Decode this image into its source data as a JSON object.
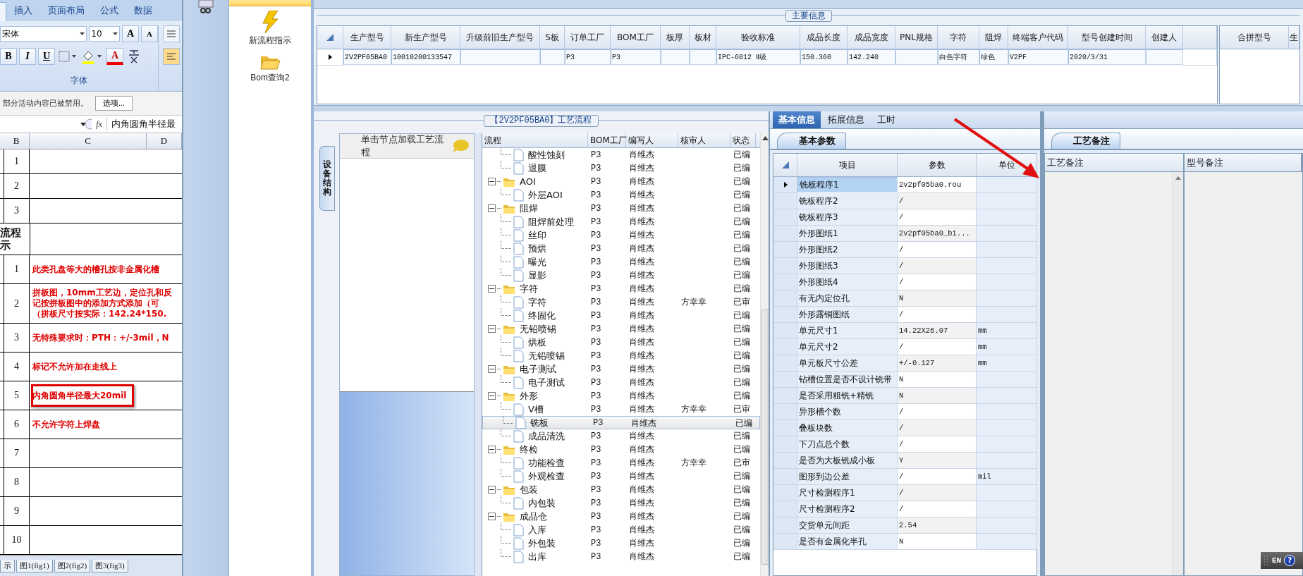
{
  "excel": {
    "ribbon_tabs": [
      "插入",
      "页面布局",
      "公式",
      "数据"
    ],
    "font_name": "宋体",
    "font_size": "10",
    "grow_font": "A",
    "shrink_font": "A",
    "format_buttons": [
      "B",
      "I",
      "U"
    ],
    "font_color_glyph": "A",
    "font_group_label": "字体",
    "security_message": "部分活动内容已被禁用。",
    "options_button": "选项...",
    "formula_fx": "fx",
    "formula_content": "内角圆角半径最",
    "columns": [
      "B",
      "C",
      "D"
    ],
    "rows": [
      {
        "kind": "item",
        "number": "1",
        "highlighted": false
      },
      {
        "kind": "item",
        "number": "2",
        "highlighted": false
      },
      {
        "kind": "item",
        "number": "3",
        "highlighted": false
      },
      {
        "kind": "label",
        "heading": [
          "流程",
          "示"
        ]
      },
      {
        "kind": "item",
        "number": "1",
        "lines": [
          "此类孔盘等大的槽孔按非金属化槽"
        ],
        "highlighted": false
      },
      {
        "kind": "item",
        "number": "2",
        "lines": [
          "拼板图，10mm工艺边，定位孔和反",
          "记按拼板图中的添加方式添加（可",
          "（拼板尺寸按实际：142.24*150."
        ],
        "highlighted": false
      },
      {
        "kind": "item",
        "number": "3",
        "lines": [
          "无特殊要求时：PTH：+/-3mil，N"
        ],
        "highlighted": false
      },
      {
        "kind": "item",
        "number": "4",
        "lines": [
          "标记不允许加在走线上"
        ],
        "highlighted": false
      },
      {
        "kind": "item",
        "number": "5",
        "lines": [
          "内角圆角半径最大20mil"
        ],
        "highlighted": true
      },
      {
        "kind": "item",
        "number": "6",
        "lines": [
          "不允许字符上焊盘"
        ],
        "highlighted": false
      },
      {
        "kind": "item",
        "number": "7",
        "highlighted": false
      },
      {
        "kind": "item",
        "number": "8",
        "highlighted": false
      },
      {
        "kind": "item",
        "number": "9",
        "highlighted": false
      },
      {
        "kind": "item",
        "number": "10",
        "highlighted": false
      }
    ],
    "sheet_tabs": [
      "示",
      "图1(fig1)",
      "图2(fig2)",
      "图3(fig3)"
    ]
  },
  "launcher": {
    "items": [
      {
        "kind": "lightning",
        "label": "新流程指示"
      },
      {
        "kind": "folder",
        "label": "Bom查询2"
      }
    ]
  },
  "main_info": {
    "title": "主要信息",
    "columns": [
      "生产型号",
      "新生产型号",
      "升级前旧生产型号",
      "S板",
      "订单工厂",
      "BOM工厂",
      "板厚",
      "板材",
      "验收标准",
      "成品长度",
      "成品宽度",
      "PNL规格",
      "字符",
      "阻焊",
      "终端客户代码",
      "型号创建时间",
      "创建人"
    ],
    "rows": [
      {
        "selected": true,
        "cells": [
          "2V2PF05BA0",
          "10010200133547",
          null,
          null,
          "P3",
          "P3",
          null,
          null,
          "IPC-6012 Ⅱ级",
          "150.360",
          "142.240",
          null,
          "白色字符",
          "绿色",
          "V2PF",
          "2020/3/31",
          null
        ]
      }
    ],
    "merge_columns": [
      "合拼型号",
      "生"
    ]
  },
  "process": {
    "title": "【2V2PF05BA0】工艺流程",
    "side_tab": "设备结构",
    "hint": "单击节点加载工艺流程",
    "columns": [
      "流程",
      "BOM工厂",
      "编写人",
      "核审人",
      "状态"
    ],
    "nodes": [
      {
        "kind": "step",
        "label": "酸性蚀刻",
        "bom": "P3",
        "author": "肖维杰",
        "status": "已编",
        "selected": false
      },
      {
        "kind": "step",
        "label": "退膜",
        "bom": "P3",
        "author": "肖维杰",
        "status": "已编",
        "selected": false
      },
      {
        "kind": "group",
        "label": "AOI",
        "bom": "P3",
        "author": "肖维杰",
        "status": "已编",
        "selected": false,
        "expanded": true,
        "children": [
          {
            "kind": "step",
            "label": "外层AOI",
            "bom": "P3",
            "author": "肖维杰",
            "status": "已编",
            "selected": false
          }
        ]
      },
      {
        "kind": "group",
        "label": "阻焊",
        "bom": "P3",
        "author": "肖维杰",
        "status": "已编",
        "selected": false,
        "expanded": true,
        "children": [
          {
            "kind": "step",
            "label": "阻焊前处理",
            "bom": "P3",
            "author": "肖维杰",
            "status": "已编",
            "selected": false
          },
          {
            "kind": "step",
            "label": "丝印",
            "bom": "P3",
            "author": "肖维杰",
            "status": "已编",
            "selected": false
          },
          {
            "kind": "step",
            "label": "预烘",
            "bom": "P3",
            "author": "肖维杰",
            "status": "已编",
            "selected": false
          },
          {
            "kind": "step",
            "label": "曝光",
            "bom": "P3",
            "author": "肖维杰",
            "status": "已编",
            "selected": false
          },
          {
            "kind": "step",
            "label": "显影",
            "bom": "P3",
            "author": "肖维杰",
            "status": "已编",
            "selected": false
          }
        ]
      },
      {
        "kind": "group",
        "label": "字符",
        "bom": "P3",
        "author": "肖维杰",
        "status": "已编",
        "selected": false,
        "expanded": true,
        "children": [
          {
            "kind": "step",
            "label": "字符",
            "bom": "P3",
            "author": "肖维杰",
            "reviewer": "方幸幸",
            "status": "已审",
            "selected": false
          },
          {
            "kind": "step",
            "label": "终固化",
            "bom": "P3",
            "author": "肖维杰",
            "status": "已编",
            "selected": false
          }
        ]
      },
      {
        "kind": "group",
        "label": "无铅喷锡",
        "bom": "P3",
        "author": "肖维杰",
        "status": "已编",
        "selected": false,
        "expanded": true,
        "children": [
          {
            "kind": "step",
            "label": "烘板",
            "bom": "P3",
            "author": "肖维杰",
            "status": "已编",
            "selected": false
          },
          {
            "kind": "step",
            "label": "无铅喷锡",
            "bom": "P3",
            "author": "肖维杰",
            "status": "已编",
            "selected": false
          }
        ]
      },
      {
        "kind": "group",
        "label": "电子测试",
        "bom": "P3",
        "author": "肖维杰",
        "status": "已编",
        "selected": false,
        "expanded": true,
        "children": [
          {
            "kind": "step",
            "label": "电子测试",
            "bom": "P3",
            "author": "肖维杰",
            "status": "已编",
            "selected": false
          }
        ]
      },
      {
        "kind": "group",
        "label": "外形",
        "bom": "P3",
        "author": "肖维杰",
        "status": "已编",
        "selected": false,
        "expanded": true,
        "children": [
          {
            "kind": "step",
            "label": "V槽",
            "bom": "P3",
            "author": "肖维杰",
            "reviewer": "方幸幸",
            "status": "已审",
            "selected": false
          },
          {
            "kind": "step",
            "label": "铣板",
            "bom": "P3",
            "author": "肖维杰",
            "status": "已编",
            "selected": true
          },
          {
            "kind": "step",
            "label": "成品清洗",
            "bom": "P3",
            "author": "肖维杰",
            "status": "已编",
            "selected": false
          }
        ]
      },
      {
        "kind": "group",
        "label": "终检",
        "bom": "P3",
        "author": "肖维杰",
        "status": "已编",
        "selected": false,
        "expanded": true,
        "children": [
          {
            "kind": "step",
            "label": "功能检查",
            "bom": "P3",
            "author": "肖维杰",
            "reviewer": "方幸幸",
            "status": "已审",
            "selected": false
          },
          {
            "kind": "step",
            "label": "外观检查",
            "bom": "P3",
            "author": "肖维杰",
            "status": "已编",
            "selected": false
          }
        ]
      },
      {
        "kind": "group",
        "label": "包装",
        "bom": "P3",
        "author": "肖维杰",
        "status": "已编",
        "selected": false,
        "expanded": true,
        "children": [
          {
            "kind": "step",
            "label": "内包装",
            "bom": "P3",
            "author": "肖维杰",
            "status": "已编",
            "selected": false
          }
        ]
      },
      {
        "kind": "group",
        "label": "成品仓",
        "bom": "P3",
        "author": "肖维杰",
        "status": "已编",
        "selected": false,
        "expanded": true,
        "children": [
          {
            "kind": "step",
            "label": "入库",
            "bom": "P3",
            "author": "肖维杰",
            "status": "已编",
            "selected": false
          },
          {
            "kind": "step",
            "label": "外包装",
            "bom": "P3",
            "author": "肖维杰",
            "status": "已编",
            "selected": false
          },
          {
            "kind": "step",
            "label": "出库",
            "bom": "P3",
            "author": "肖维杰",
            "status": "已编",
            "selected": false
          }
        ]
      }
    ]
  },
  "basic": {
    "tabs": [
      {
        "label": "基本信息",
        "selected": true
      },
      {
        "label": "拓展信息",
        "selected": false
      },
      {
        "label": "工时",
        "selected": false
      }
    ],
    "subtab": "基本参数",
    "columns": [
      "项目",
      "参数",
      "单位"
    ],
    "rows": [
      {
        "item": "铣板程序1",
        "value": "2v2pf05ba0.rou",
        "selected": true
      },
      {
        "item": "铣板程序2",
        "value": "/",
        "selected": false
      },
      {
        "item": "铣板程序3",
        "value": "/",
        "selected": false
      },
      {
        "item": "外形图纸1",
        "value": "2v2pf05ba0_bi...",
        "selected": false
      },
      {
        "item": "外形图纸2",
        "value": "/",
        "selected": false
      },
      {
        "item": "外形图纸3",
        "value": "/",
        "selected": false
      },
      {
        "item": "外形图纸4",
        "value": "/",
        "selected": false
      },
      {
        "item": "有无内定位孔",
        "value": "N",
        "selected": false
      },
      {
        "item": "外形露铜图纸",
        "value": "/",
        "selected": false
      },
      {
        "item": "单元尺寸1",
        "value": "14.22X26.07",
        "unit": "mm",
        "selected": false
      },
      {
        "item": "单元尺寸2",
        "value": "/",
        "unit": "mm",
        "selected": false
      },
      {
        "item": "单元板尺寸公差",
        "value": "+/-0.127",
        "unit": "mm",
        "selected": false
      },
      {
        "item": "钻槽位置是否不设计铣带",
        "value": "N",
        "selected": false
      },
      {
        "item": "是否采用粗铣+精铣",
        "value": "N",
        "selected": false
      },
      {
        "item": "异形槽个数",
        "value": "/",
        "selected": false
      },
      {
        "item": "叠板块数",
        "value": "/",
        "selected": false
      },
      {
        "item": "下刀点总个数",
        "value": "/",
        "selected": false
      },
      {
        "item": "是否为大板铣成小板",
        "value": "Y",
        "selected": false
      },
      {
        "item": "图形到边公差",
        "value": "/",
        "unit": "mil",
        "selected": false
      },
      {
        "item": "尺寸检测程序1",
        "value": "/",
        "selected": false
      },
      {
        "item": "尺寸检测程序2",
        "value": "/",
        "selected": false
      },
      {
        "item": "交货单元间距",
        "value": "2.54",
        "selected": false
      },
      {
        "item": "是否有金属化半孔",
        "value": "N",
        "selected": false
      }
    ]
  },
  "notes": {
    "tab": "工艺备注",
    "columns": [
      "工艺备注",
      "型号备注"
    ]
  },
  "ime": {
    "label": "EN",
    "help": "?"
  }
}
